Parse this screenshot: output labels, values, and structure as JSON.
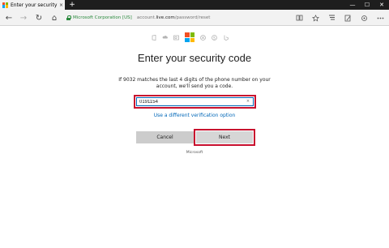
{
  "browser": {
    "tab_title": "Enter your security code",
    "tab_close": "×",
    "new_tab": "+",
    "window_controls": [
      "—",
      "☐",
      "✕"
    ],
    "nav": {
      "back_icon": "←",
      "forward_icon": "→",
      "refresh_icon": "↻",
      "home_icon": "⌂"
    },
    "address": {
      "cert_label": "Microsoft Corporation [US]",
      "url_prefix": "account.",
      "url_domain": "live.com",
      "url_path": "/password/reset"
    },
    "right_icons": [
      "reading-view-icon",
      "favorite-star-icon",
      "hub-icon",
      "notes-icon",
      "share-icon",
      "more-icon"
    ]
  },
  "page": {
    "heading": "Enter your security code",
    "description": "If 9032 matches the last 4 digits of the phone number on your account, we'll send you a code.",
    "code_input": {
      "value": "0191154",
      "clear_symbol": "×"
    },
    "alternate_link": "Use a different verification option",
    "cancel_label": "Cancel",
    "next_label": "Next",
    "footer": "Microsoft"
  },
  "colors": {
    "ms_red": "#f25022",
    "ms_green": "#7fba00",
    "ms_blue": "#00a4ef",
    "ms_yellow": "#ffb900",
    "link_blue": "#0067b8",
    "highlight_red": "#c8102e",
    "secure_green": "#2b8a3e"
  }
}
